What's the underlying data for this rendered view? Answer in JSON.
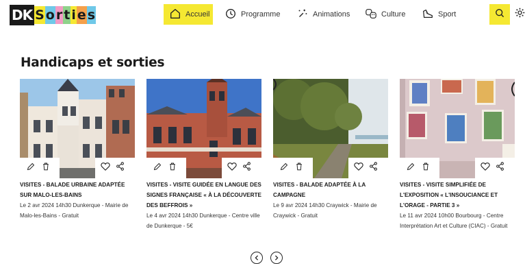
{
  "logo": {
    "dk": "DK",
    "letters": [
      "S",
      "o",
      "r",
      "t",
      "i",
      "e",
      "s"
    ],
    "letter_colors": [
      "#f5e832",
      "#6fc8e8",
      "#f29bc4",
      "#8fd28a",
      "#f5e832",
      "#f5a04a",
      "#6fc8e8"
    ]
  },
  "nav": {
    "items": [
      {
        "label": "Accueil",
        "icon": "home-icon"
      },
      {
        "label": "Programme",
        "icon": "clock-icon"
      },
      {
        "label": "Animations",
        "icon": "sparkle-icon"
      },
      {
        "label": "Culture",
        "icon": "masks-icon"
      },
      {
        "label": "Sport",
        "icon": "shoe-icon"
      }
    ],
    "active_color": "#f5e832",
    "search_icon": "search-icon",
    "settings_icon": "gear-icon"
  },
  "section": {
    "title": "Handicaps et sorties"
  },
  "cards": [
    {
      "title": "VISITES - BALADE URBAINE ADAPTÉE SUR MALO-LES-BAINS",
      "info": "Le 2 avr 2024 14h30 Dunkerque - Mairie de Malo-les-Bains - Gratuit"
    },
    {
      "title": "VISITES - VISITE GUIDÉE EN LANGUE DES SIGNES FRANÇAISE « À LA DÉCOUVERTE DES BEFFROIS »",
      "info": "Le 4 avr 2024 14h30 Dunkerque - Centre ville de Dunkerque - 5€"
    },
    {
      "title": "VISITES - BALADE ADAPTÉE À LA CAMPAGNE",
      "info": "Le 9 avr 2024 14h30 Craywick - Mairie de Craywick - Gratuit"
    },
    {
      "title": "VISITES - VISITE SIMPLIFIÉE DE L'EXPOSITION « L'INSOUCIANCE ET L'ORAGE - PARTIE 3 »",
      "info": "Le 11 avr 2024 10h00 Bourbourg - Centre Interprétation Art et Culture (CIAC) - Gratuit"
    }
  ],
  "pager": {
    "prev_icon": "chevron-left-icon",
    "next_icon": "chevron-right-icon"
  }
}
